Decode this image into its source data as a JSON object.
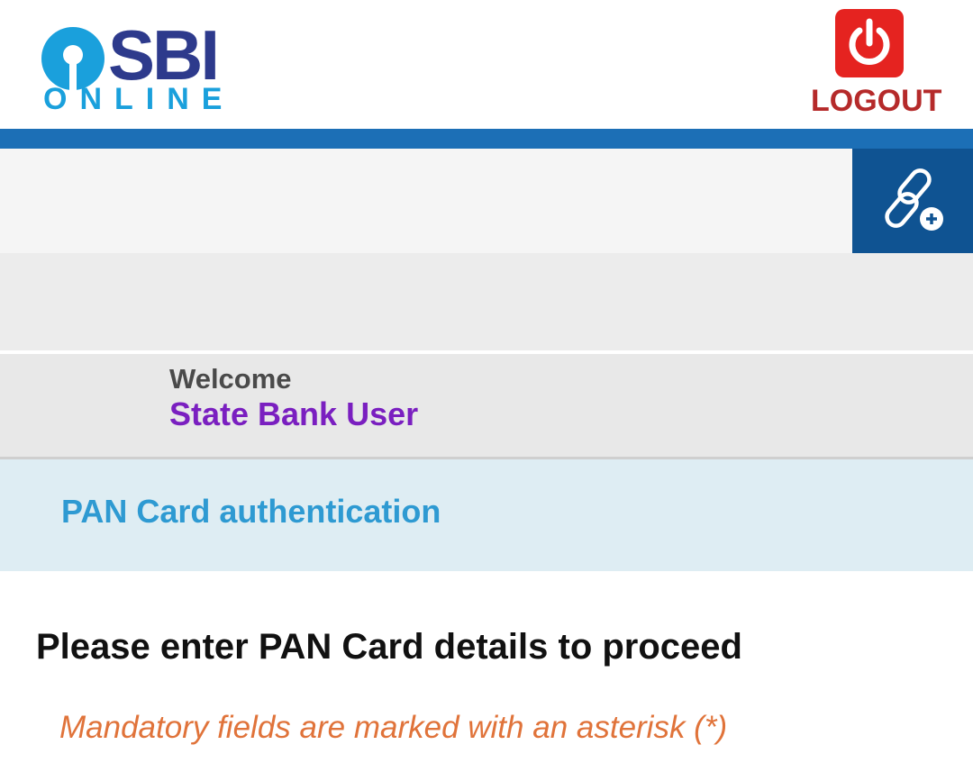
{
  "header": {
    "logo_brand": "SBI",
    "logo_sub": "ONLINE",
    "logout_label": "LOGOUT",
    "logout_icon": "power-icon",
    "brand_colors": {
      "sbi_text": "#2d3a8c",
      "online_text": "#1aa0dc",
      "logout_red": "#e52320"
    }
  },
  "toolbar": {
    "link_icon": "link-add-icon",
    "accent": "#0f5392"
  },
  "welcome": {
    "label": "Welcome",
    "user_name": "State Bank User"
  },
  "section": {
    "title": "PAN Card authentication"
  },
  "content": {
    "heading": "Please enter PAN Card details to proceed",
    "mandatory_note": "Mandatory fields are marked with an asterisk (*)"
  }
}
